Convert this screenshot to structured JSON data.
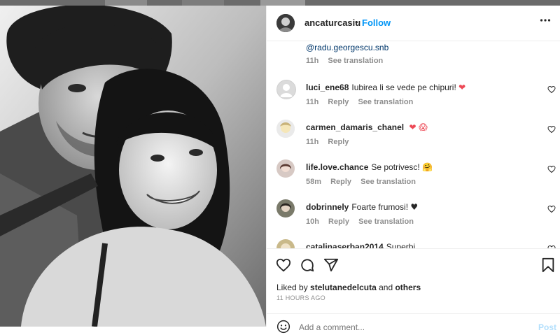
{
  "post": {
    "username": "ancaturcasiu",
    "separator": "•",
    "follow_label": "Follow",
    "more_label": "•••"
  },
  "comments": {
    "mention": "@radu.georgescu.snb",
    "mention_time": "11h",
    "see_translation": "See translation",
    "reply_label": "Reply",
    "items": [
      {
        "user": "luci_ene68",
        "text": "Iubirea li se vede pe chipuri!",
        "emoji": "❤",
        "time": "11h",
        "reply": "Reply",
        "translate": "See translation"
      },
      {
        "user": "carmen_damaris_chanel",
        "text": "",
        "emoji": "❤ 😱",
        "time": "11h",
        "reply": "Reply",
        "translate": ""
      },
      {
        "user": "life.love.chance",
        "text": "Se potrivesc!",
        "emoji": "🤗",
        "time": "58m",
        "reply": "Reply",
        "translate": "See translation"
      },
      {
        "user": "dobrinnely",
        "text": "Foarte frumosi!",
        "emoji": "♥",
        "time": "10h",
        "reply": "Reply",
        "translate": "See translation"
      },
      {
        "user": "catalinaserban2014",
        "text": "Superbi",
        "emoji": "",
        "time": "",
        "reply": "",
        "translate": ""
      }
    ]
  },
  "likes": {
    "prefix": "Liked by",
    "user": "stelutanedelcuta",
    "and": "and",
    "others": "others",
    "timestamp": "11 HOURS AGO"
  },
  "add_comment": {
    "placeholder": "Add a comment...",
    "post_label": "Post"
  },
  "colors": {
    "link": "#0095f6",
    "mention": "#00376b",
    "muted": "#8e8e8e",
    "heart_red": "#ed4956"
  },
  "icons": [
    "heart-icon",
    "comment-icon",
    "share-icon",
    "bookmark-icon",
    "emoji-icon",
    "more-icon"
  ]
}
